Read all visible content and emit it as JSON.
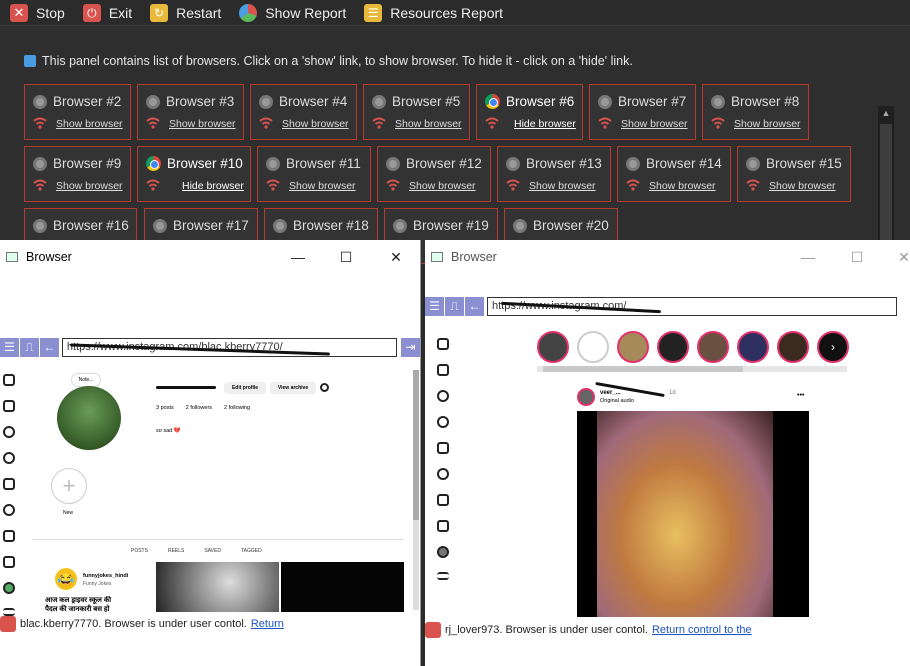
{
  "toolbar": {
    "stop": "Stop",
    "exit": "Exit",
    "restart": "Restart",
    "show_report": "Show Report",
    "resources_report": "Resources Report"
  },
  "panel": {
    "info": "This panel contains list of browsers. Click on a 'show' link, to show browser. To hide it - click on a 'hide' link."
  },
  "browsers": [
    {
      "name": "Browser #2",
      "link": "Show browser"
    },
    {
      "name": "Browser #3",
      "link": "Show browser"
    },
    {
      "name": "Browser #4",
      "link": "Show browser"
    },
    {
      "name": "Browser #5",
      "link": "Show browser"
    },
    {
      "name": "Browser #6",
      "link": "Hide browser"
    },
    {
      "name": "Browser #7",
      "link": "Show browser"
    },
    {
      "name": "Browser #8",
      "link": "Show browser"
    },
    {
      "name": "Browser #9",
      "link": "Show browser"
    },
    {
      "name": "Browser #10",
      "link": "Hide browser"
    },
    {
      "name": "Browser #11",
      "link": "Show browser"
    },
    {
      "name": "Browser #12",
      "link": "Show browser"
    },
    {
      "name": "Browser #13",
      "link": "Show browser"
    },
    {
      "name": "Browser #14",
      "link": "Show browser"
    },
    {
      "name": "Browser #15",
      "link": "Show browser"
    },
    {
      "name": "Browser #16",
      "link": ""
    },
    {
      "name": "Browser #17",
      "link": ""
    },
    {
      "name": "Browser #18",
      "link": ""
    },
    {
      "name": "Browser #19",
      "link": ""
    },
    {
      "name": "Browser #20",
      "link": ""
    }
  ],
  "left_window": {
    "title": "Browser",
    "url": "https://www.instagram.com/blac.kberry7770/",
    "profile": {
      "edit": "Edit profile",
      "archive": "View archive",
      "posts": "3 posts",
      "followers": "2 followers",
      "following": "2 following",
      "bio": "so sad 💔",
      "note": "Note...",
      "new": "New",
      "tabs": [
        "POSTS",
        "REELS",
        "SAVED",
        "TAGGED"
      ],
      "suggest_name": "funnyjokes_hindi",
      "suggest_sub": "Funny Jokes",
      "suggest_text": "आज कल ड्राइवर स्कूल की पैदल की जानकारी बस हो"
    },
    "status_user": "blac.kberry7770. Browser is under user contol.",
    "status_link": "Return"
  },
  "right_window": {
    "title": "Browser",
    "url": "https://www.instagram.com/",
    "post": {
      "user": "veer_...",
      "time": "1d",
      "sub": "Original audio",
      "menu": "•••"
    },
    "status_user": "rj_lover973. Browser is under user contol.",
    "status_link": "Return control to the"
  },
  "colors": {
    "card_border": "#b33a2e",
    "accent": "#8a8fd1",
    "link": "#1a55c4"
  }
}
